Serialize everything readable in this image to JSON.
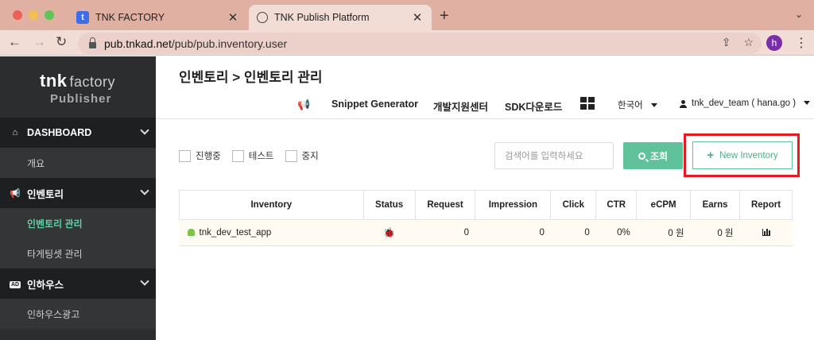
{
  "browser": {
    "tabs": [
      {
        "title": "TNK FACTORY",
        "favicon": "tnk-t-icon",
        "active": false
      },
      {
        "title": "TNK Publish Platform",
        "favicon": "globe-icon",
        "active": true
      }
    ],
    "url_host": "pub.tnkad.net",
    "url_path": "/pub/pub.inventory.user",
    "profile_initial": "h"
  },
  "sidebar": {
    "brand_main": "tnk",
    "brand_factory": "factory",
    "brand_sub": "Publisher",
    "sections": [
      {
        "label": "DASHBOARD",
        "icon": "home-icon",
        "items": [
          {
            "label": "개요",
            "active": false
          }
        ]
      },
      {
        "label": "인벤토리",
        "icon": "megaphone-icon",
        "items": [
          {
            "label": "인벤토리 관리",
            "active": true
          },
          {
            "label": "타게팅셋 관리",
            "active": false
          }
        ]
      },
      {
        "label": "인하우스",
        "icon": "ad-icon",
        "items": [
          {
            "label": "인하우스광고",
            "active": false
          }
        ]
      }
    ],
    "ad_badge": "AD"
  },
  "breadcrumb": "인벤토리 > 인벤토리 관리",
  "topnav": {
    "snippet": "Snippet Generator",
    "devcenter": "개발지원센터",
    "sdk": "SDK다운로드",
    "language": "한국어",
    "user": "tnk_dev_team ( hana.go )"
  },
  "filters": {
    "checkboxes": [
      "진행중",
      "테스트",
      "중지"
    ],
    "search_placeholder": "검색어를 입력하세요",
    "search_button": "조회",
    "new_inventory_button": "New Inventory"
  },
  "table": {
    "headers": [
      "Inventory",
      "Status",
      "Request",
      "Impression",
      "Click",
      "CTR",
      "eCPM",
      "Earns",
      "Report"
    ],
    "rows": [
      {
        "name": "tnk_dev_test_app",
        "platform": "android-icon",
        "status": "bug-icon",
        "request": "0",
        "impression": "0",
        "click": "0",
        "ctr": "0%",
        "ecpm": "0 원",
        "earns": "0 원",
        "report": "bar-chart-icon"
      }
    ]
  },
  "colors": {
    "accent": "#5fc29a",
    "highlight": "#e31b23",
    "sidebar": "#2b2d2f",
    "active_menu": "#5fd1a6"
  }
}
